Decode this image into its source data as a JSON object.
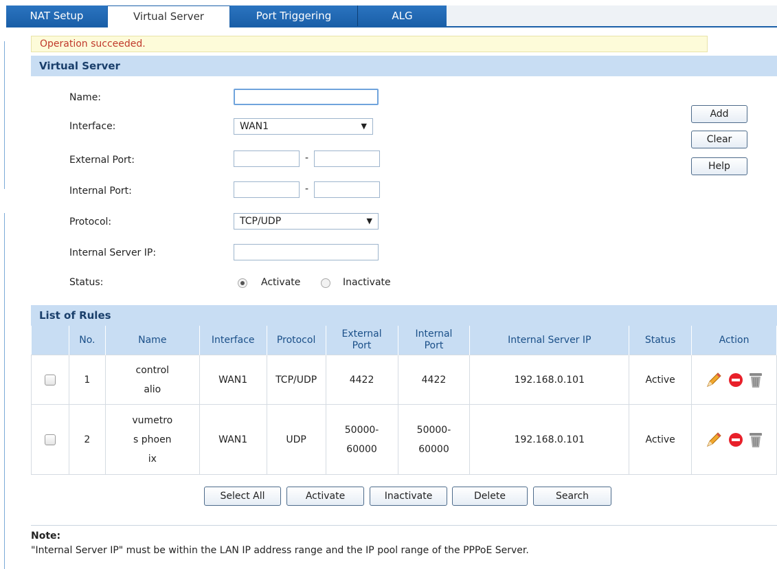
{
  "tabs": [
    {
      "label": "NAT Setup",
      "active": false
    },
    {
      "label": "Virtual Server",
      "active": true
    },
    {
      "label": "Port Triggering",
      "active": false
    },
    {
      "label": "ALG",
      "active": false
    }
  ],
  "message": "Operation succeeded.",
  "virtual_server": {
    "title": "Virtual Server",
    "labels": {
      "name": "Name:",
      "interface": "Interface:",
      "external_port": "External Port:",
      "internal_port": "Internal Port:",
      "protocol": "Protocol:",
      "internal_server_ip": "Internal Server IP:",
      "status": "Status:"
    },
    "values": {
      "name": "",
      "interface": "WAN1",
      "external_port_start": "",
      "external_port_end": "",
      "internal_port_start": "",
      "internal_port_end": "",
      "protocol": "TCP/UDP",
      "internal_server_ip": ""
    },
    "port_dash": "-",
    "status_options": {
      "activate": "Activate",
      "inactivate": "Inactivate",
      "selected": "Activate"
    },
    "buttons": {
      "add": "Add",
      "clear": "Clear",
      "help": "Help"
    }
  },
  "rules": {
    "title": "List of Rules",
    "headers": {
      "no": "No.",
      "name": "Name",
      "interface": "Interface",
      "protocol": "Protocol",
      "external_port_1": "External",
      "external_port_2": "Port",
      "internal_port_1": "Internal",
      "internal_port_2": "Port",
      "internal_server_ip": "Internal Server IP",
      "status": "Status",
      "action": "Action"
    },
    "rows": [
      {
        "no": "1",
        "name_lines": [
          "control",
          "alio"
        ],
        "interface": "WAN1",
        "protocol": "TCP/UDP",
        "ext_lines": [
          "4422"
        ],
        "int_lines": [
          "4422"
        ],
        "ip": "192.168.0.101",
        "status": "Active"
      },
      {
        "no": "2",
        "name_lines": [
          "vumetro",
          "s phoen",
          "ix"
        ],
        "interface": "WAN1",
        "protocol": "UDP",
        "ext_lines": [
          "50000-",
          "60000"
        ],
        "int_lines": [
          "50000-",
          "60000"
        ],
        "ip": "192.168.0.101",
        "status": "Active"
      }
    ],
    "action_icons": [
      "edit-pencil-icon",
      "disable-icon",
      "delete-trash-icon"
    ]
  },
  "bottom_buttons": {
    "select_all": "Select All",
    "activate": "Activate",
    "inactivate": "Inactivate",
    "delete": "Delete",
    "search": "Search"
  },
  "note": {
    "title": "Note:",
    "text": "\"Internal Server IP\" must be within the LAN IP address range and the IP pool range of the PPPoE Server."
  },
  "colors": {
    "tab_blue": "#1a5fa8",
    "section_bar": "#c8ddf3",
    "message_bg": "#fdfbd9",
    "message_text": "#c0392b"
  }
}
